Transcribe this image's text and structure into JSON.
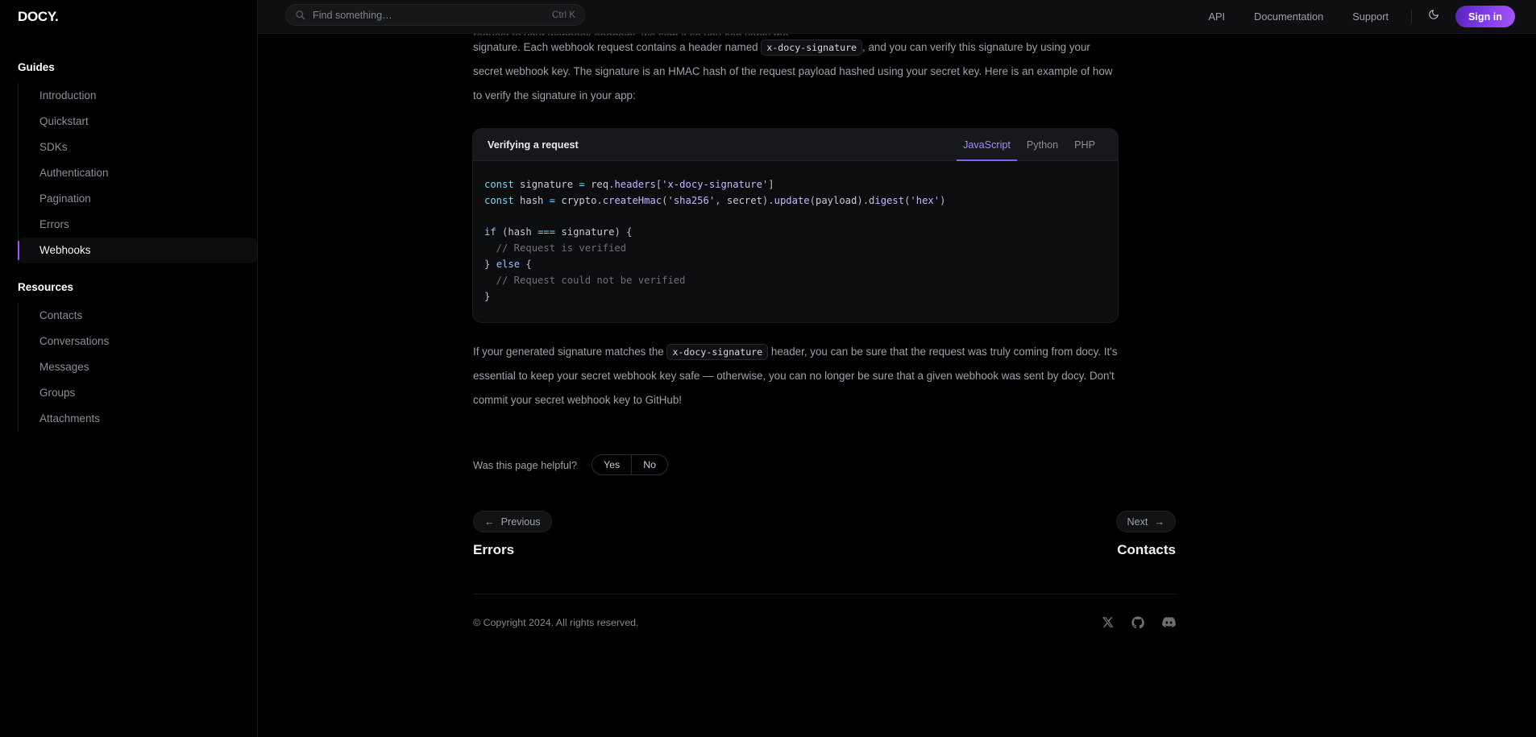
{
  "brand": {
    "name": "DOCY."
  },
  "search": {
    "placeholder": "Find something…",
    "shortcut": "Ctrl K",
    "icon": "search-icon"
  },
  "header": {
    "links": [
      {
        "label": "API"
      },
      {
        "label": "Documentation"
      },
      {
        "label": "Support"
      }
    ],
    "theme_toggle_icon": "moon-icon",
    "signin_label": "Sign in",
    "accent_color": "#8b5cf6"
  },
  "sidebar": {
    "sections": [
      {
        "title": "Guides",
        "items": [
          {
            "label": "Introduction",
            "active": false
          },
          {
            "label": "Quickstart",
            "active": false
          },
          {
            "label": "SDKs",
            "active": false
          },
          {
            "label": "Authentication",
            "active": false
          },
          {
            "label": "Pagination",
            "active": false
          },
          {
            "label": "Errors",
            "active": false
          },
          {
            "label": "Webhooks",
            "active": true
          }
        ]
      },
      {
        "title": "Resources",
        "items": [
          {
            "label": "Contacts",
            "active": false
          },
          {
            "label": "Conversations",
            "active": false
          },
          {
            "label": "Messages",
            "active": false
          },
          {
            "label": "Groups",
            "active": false
          },
          {
            "label": "Attachments",
            "active": false
          }
        ]
      }
    ]
  },
  "content": {
    "clipped_line": "request to your webhook endpoint, we sign it so you can verify the",
    "para1_a": "signature. Each webhook request contains a header named",
    "para1_code": "x-docy-signature",
    "para1_b": ", and you can verify this signature by using your secret webhook key. The signature is an HMAC hash of the request payload hashed using your secret key. Here is an example of how to verify the signature in your app:",
    "para2_a": "If your generated signature matches the",
    "para2_code": "x-docy-signature",
    "para2_b": "header, you can be sure that the request was truly coming from docy. It's essential to keep your secret webhook key safe — otherwise, you can no longer be sure that a given webhook was sent by docy. Don't commit your secret webhook key to GitHub!"
  },
  "code_block": {
    "title": "Verifying a request",
    "tabs": [
      {
        "label": "JavaScript",
        "active": true
      },
      {
        "label": "Python",
        "active": false
      },
      {
        "label": "PHP",
        "active": false
      }
    ],
    "lines": {
      "l1_kw": "const",
      "l1_var": " signature ",
      "l1_eq": "=",
      "l1_obj": " req",
      "l1_dot": ".",
      "l1_prop": "headers",
      "l1_br_open": "[",
      "l1_str": "'x-docy-signature'",
      "l1_br_close": "]",
      "l2_kw": "const",
      "l2_var": " hash ",
      "l2_eq": "=",
      "l2_obj": " crypto",
      "l2_dot1": ".",
      "l2_fn1": "createHmac",
      "l2_p1": "(",
      "l2_str1": "'sha256'",
      "l2_comma": ", ",
      "l2_arg1": "secret",
      "l2_p2": ")",
      "l2_dot2": ".",
      "l2_fn2": "update",
      "l2_p3": "(",
      "l2_arg2": "payload",
      "l2_p4": ")",
      "l2_dot3": ".",
      "l2_fn3": "digest",
      "l2_p5": "(",
      "l2_str2": "'hex'",
      "l2_p6": ")",
      "l4_kw": "if",
      "l4_p1": " (",
      "l4_v1": "hash ",
      "l4_op": "===",
      "l4_v2": " signature",
      "l4_p2": ") {",
      "l5_comment": "  // Request is verified",
      "l6_brace": "} ",
      "l6_kw": "else",
      "l6_open": " {",
      "l7_comment": "  // Request could not be verified",
      "l8_brace": "}"
    }
  },
  "feedback": {
    "question": "Was this page helpful?",
    "yes_label": "Yes",
    "no_label": "No"
  },
  "pagination": {
    "previous_label": "Previous",
    "previous_arrow": "←",
    "previous_title": "Errors",
    "next_label": "Next",
    "next_arrow": "→",
    "next_title": "Contacts"
  },
  "footer": {
    "copyright": "© Copyright 2024. All rights reserved.",
    "socials": [
      {
        "name": "x-twitter-icon"
      },
      {
        "name": "github-icon"
      },
      {
        "name": "discord-icon"
      }
    ]
  }
}
